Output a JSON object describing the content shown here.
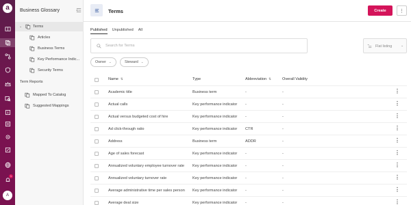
{
  "rail": {
    "logo": "a",
    "avatar": "A",
    "notification_count": "1",
    "icons": [
      "book-icon",
      "glossary-icon",
      "lineage-icon",
      "shield-icon",
      "crown-icon",
      "stack-search-icon",
      "info-icon",
      "list-icon",
      "gear-icon",
      "edit-icon",
      "globe-icon",
      "bell-icon"
    ]
  },
  "side": {
    "title": "Business Glossary",
    "items": [
      {
        "label": "Terms"
      },
      {
        "label": "Articles"
      },
      {
        "label": "Business Terms"
      },
      {
        "label": "Key Performance Indic..."
      },
      {
        "label": "Security Terms"
      },
      {
        "label": "Term Reports"
      },
      {
        "label": "Mapped To Catalog"
      },
      {
        "label": "Suggested Mappings"
      }
    ]
  },
  "header": {
    "title": "Terms",
    "create_label": "Create",
    "more_label": "⋮"
  },
  "tabs": [
    {
      "label": "Published"
    },
    {
      "label": "Unpublished"
    },
    {
      "label": "All"
    }
  ],
  "search": {
    "placeholder": "Search for Terms"
  },
  "listing": {
    "label": "Flat listing"
  },
  "filters": [
    {
      "label": "Owner"
    },
    {
      "label": "Steward"
    }
  ],
  "table": {
    "columns": [
      "Name",
      "Type",
      "Abbreviation",
      "Overall Validity"
    ],
    "rows": [
      {
        "name": "Academic title",
        "type": "Business term",
        "abbr": "-",
        "validity": "-"
      },
      {
        "name": "Actual calls",
        "type": "Key performance indicator",
        "abbr": "-",
        "validity": "-"
      },
      {
        "name": "Actual versus budgeted cost of hire",
        "type": "Key performance indicator",
        "abbr": "-",
        "validity": "-"
      },
      {
        "name": "Ad click-through ratio",
        "type": "Key performance indicator",
        "abbr": "CTR",
        "validity": "-"
      },
      {
        "name": "Address",
        "type": "Business term",
        "abbr": "ADDR",
        "validity": "-"
      },
      {
        "name": "Age of sales forecast",
        "type": "Key performance indicator",
        "abbr": "-",
        "validity": "-"
      },
      {
        "name": "Annualized voluntary employee turnover rate",
        "type": "Key performance indicator",
        "abbr": "-",
        "validity": "-"
      },
      {
        "name": "Annualized voluntary turnover rate",
        "type": "Key performance indicator",
        "abbr": "-",
        "validity": "-"
      },
      {
        "name": "Average administrative time per sales person",
        "type": "Key performance indicator",
        "abbr": "-",
        "validity": "-"
      },
      {
        "name": "Average deal size",
        "type": "Key performance indicator",
        "abbr": "-",
        "validity": "-"
      }
    ]
  }
}
